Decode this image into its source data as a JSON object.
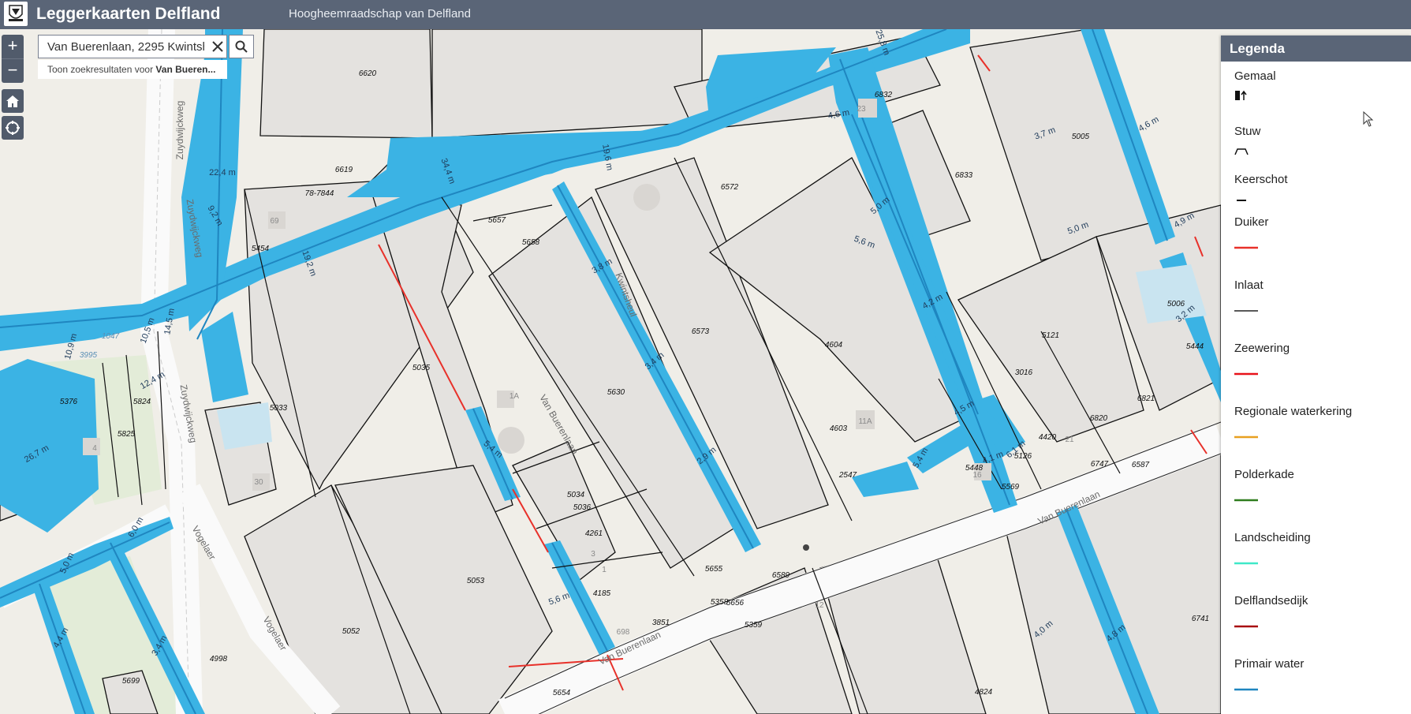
{
  "header": {
    "app_title": "Leggerkaarten Delfland",
    "organization": "Hoogheemraadschap van Delfland"
  },
  "search": {
    "value": "Van Buerenlaan, 2295 Kwintsheul",
    "suggestion_prefix": "Toon zoekresultaten voor ",
    "suggestion_term": "Van Bueren..."
  },
  "controls": {
    "zoom_in": "+",
    "zoom_out": "−"
  },
  "legend": {
    "title": "Legenda",
    "items": [
      {
        "label": "Gemaal",
        "symbol": "gemaal-icon",
        "color": "#000000"
      },
      {
        "label": "Stuw",
        "symbol": "stuw-icon",
        "color": "#000000"
      },
      {
        "label": "Keerschot",
        "symbol": "keerschot-icon",
        "color": "#000000"
      },
      {
        "label": "Duiker",
        "symbol": "line",
        "color": "#e8312a"
      },
      {
        "label": "Inlaat",
        "symbol": "line",
        "color": "#222222"
      },
      {
        "label": "Zeewering",
        "symbol": "line",
        "color": "#e8121a"
      },
      {
        "label": "Regionale waterkering",
        "symbol": "line",
        "color": "#e8a020"
      },
      {
        "label": "Polderkade",
        "symbol": "line",
        "color": "#2f7d1e"
      },
      {
        "label": "Landscheiding",
        "symbol": "line",
        "color": "#3fe8c8"
      },
      {
        "label": "Delflandsedijk",
        "symbol": "line",
        "color": "#a80f12"
      },
      {
        "label": "Primair water",
        "symbol": "line",
        "color": "#1f86c0"
      }
    ]
  },
  "map": {
    "colors": {
      "water": "#3bb3e4",
      "primary_water": "#1f86c0",
      "parcel": "#e4e2df",
      "land": "#f0eee8",
      "grass": "#e3ecd8",
      "road": "#ffffff"
    },
    "parcel_labels": [
      "6620",
      "6832",
      "5005",
      "6833",
      "6619",
      "78-7844",
      "6572",
      "5657",
      "5658",
      "5454",
      "6573",
      "4604",
      "5121",
      "5006",
      "5444",
      "3016",
      "5035",
      "5630",
      "5033",
      "5376",
      "5824",
      "5825",
      "4603",
      "6821",
      "6820",
      "4420",
      "2547",
      "5448",
      "5126",
      "6747",
      "6587",
      "5569",
      "5034",
      "5036",
      "4261",
      "5053",
      "5655",
      "6589",
      "4185",
      "5358",
      "5656",
      "5359",
      "3851",
      "5052",
      "4998",
      "5699",
      "6741",
      "4824",
      "5654",
      "1047",
      "3995"
    ],
    "house_numbers": [
      "69",
      "23",
      "1A",
      "11A",
      "4",
      "30",
      "3",
      "1",
      "12",
      "698",
      "16",
      "21"
    ],
    "width_labels": [
      "22,4 m",
      "34,4 m",
      "19,6 m",
      "19,2 m",
      "10,9 m",
      "14,5 m",
      "10,5 m",
      "12,4 m",
      "26,7 m",
      "6,0 m",
      "5,0 m",
      "4,4 m",
      "3,4 m",
      "3,8 m",
      "3,4 m",
      "2,9 m",
      "5,4 m",
      "5,6 m",
      "5,4 m",
      "4,6 m",
      "5,0 m",
      "4,2 m",
      "6,1 m",
      "3,7 m",
      "5,0 m",
      "4,6 m",
      "4,9 m",
      "3,2 m",
      "4,8 m",
      "25,8 m",
      "5,6 m",
      "4,5 m",
      "4,1 m",
      "4,0 m",
      "9,2 m"
    ],
    "street_labels": [
      "Zuydwijckweg",
      "Zuydwijckweg",
      "Zuydwijckweg",
      "Van Buerenlaan",
      "Van Buerenlaan",
      "Van Buerenlaan",
      "Vogelaer",
      "Vogelaer",
      "Kwintsheul"
    ]
  }
}
